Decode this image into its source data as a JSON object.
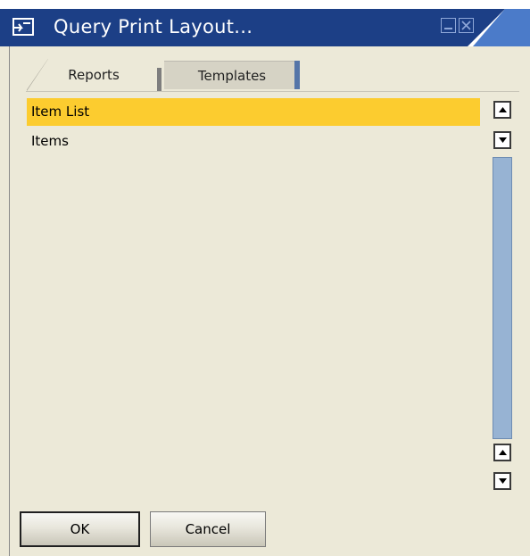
{
  "window": {
    "title": "Query Print Layout..."
  },
  "tabs": [
    {
      "label": "Reports",
      "active": true
    },
    {
      "label": "Templates",
      "active": false
    }
  ],
  "list": {
    "items": [
      {
        "label": "Item List",
        "selected": true
      },
      {
        "label": "Items",
        "selected": false
      }
    ]
  },
  "buttons": {
    "ok_label": "OK",
    "cancel_label": "Cancel"
  },
  "icons": {
    "app": "query-print-icon",
    "minimize": "minimize-icon",
    "close": "close-icon",
    "scroll_up": "arrow-up-icon",
    "scroll_down": "arrow-down-icon"
  },
  "colors": {
    "titlebar": "#1c3f86",
    "titlebar_accent": "#4b7bc9",
    "selection": "#fccc2f",
    "window_bg": "#ece9d8",
    "scroll_track": "#97b3d3"
  }
}
